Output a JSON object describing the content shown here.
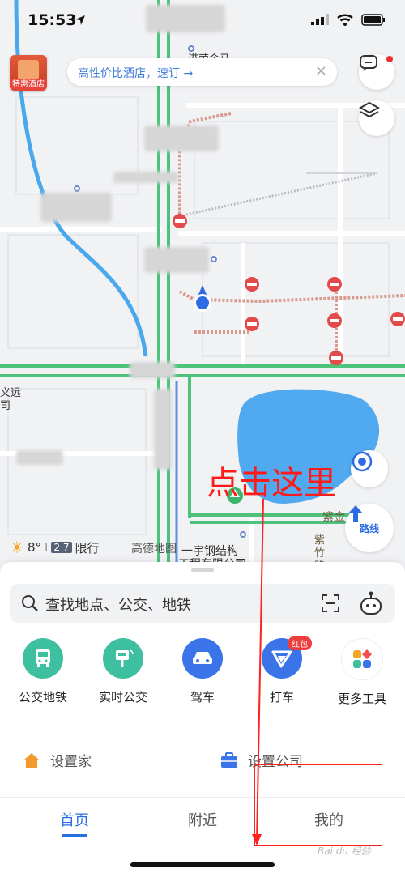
{
  "status": {
    "time": "15:53"
  },
  "promo": {
    "text": "高性价比酒店，速订 →",
    "close": "×"
  },
  "hotel_badge": {
    "label": "特惠酒店"
  },
  "map_buttons": {
    "feedback_icon": "chat-icon",
    "layers_icon": "layers-icon",
    "locate_icon": "locate-icon",
    "route_label": "路线"
  },
  "map_labels": {
    "top_label": "港荣金马",
    "left_label_1": "义远",
    "left_label_2": "司",
    "company_1": "一宇钢结构",
    "company_2": "工程有限公司",
    "right_1": "紫金",
    "right_2": "紫",
    "right_3": "竹",
    "right_4": "路"
  },
  "weather": {
    "temp": "8°",
    "sep": "I",
    "limit_num": "2 7",
    "limit_text": "限行"
  },
  "gaode_label": "高德地图",
  "annotation": {
    "text": "点击这里",
    "color": "#ff1a1a"
  },
  "search": {
    "placeholder": "查找地点、公交、地铁"
  },
  "tools": [
    {
      "label": "公交地铁",
      "icon": "bus-icon",
      "color": "#3dbfa0"
    },
    {
      "label": "实时公交",
      "icon": "bus-stop-icon",
      "color": "#3dbfa0"
    },
    {
      "label": "驾车",
      "icon": "car-icon",
      "color": "#3a74e8"
    },
    {
      "label": "打车",
      "icon": "taxi-icon",
      "color": "#3a74e8",
      "badge": "红包"
    },
    {
      "label": "更多工具",
      "icon": "apps-icon",
      "color": "#ffffff"
    }
  ],
  "places": {
    "home": "设置家",
    "company": "设置公司"
  },
  "tabs": {
    "home": "首页",
    "nearby": "附近",
    "mine": "我的"
  },
  "watermark": "Bai du 经验"
}
